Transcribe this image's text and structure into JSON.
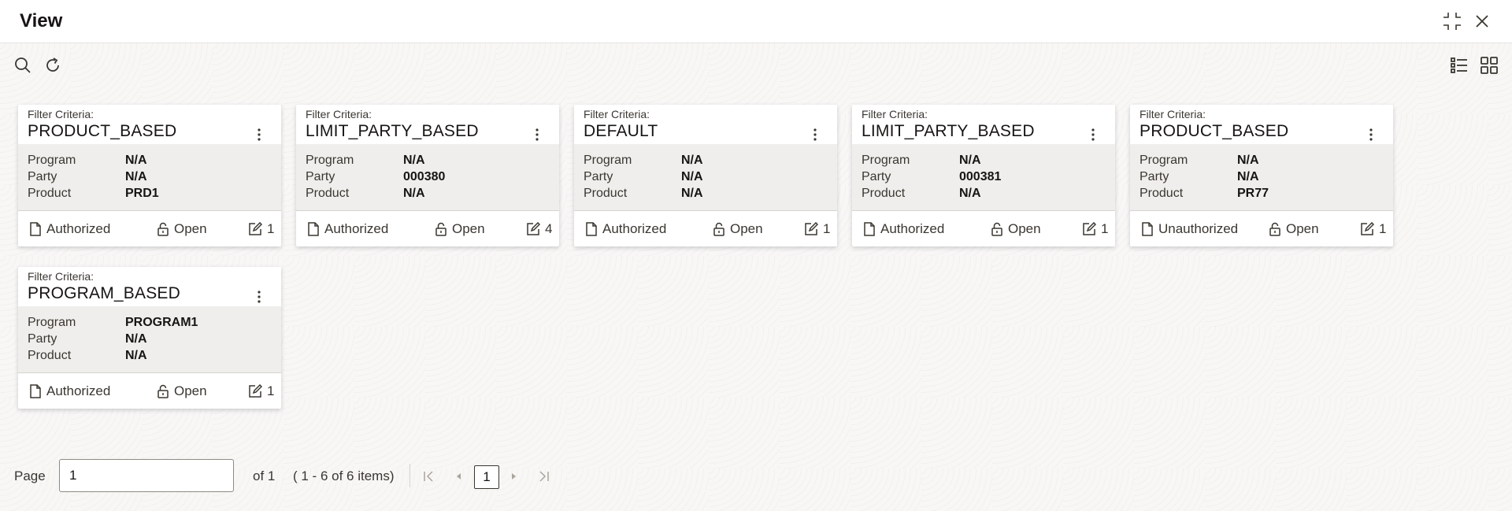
{
  "window": {
    "title": "View"
  },
  "icons": {
    "header": [
      "collapse-icon",
      "close-icon"
    ],
    "toolbar": [
      "search-icon",
      "refresh-icon",
      "list-view-icon",
      "grid-view-icon"
    ]
  },
  "cards": [
    {
      "filter_label": "Filter Criteria:",
      "criteria": "PRODUCT_BASED",
      "rows": [
        {
          "label": "Program",
          "value": "N/A"
        },
        {
          "label": "Party",
          "value": "N/A"
        },
        {
          "label": "Product",
          "value": "PRD1"
        }
      ],
      "status": "Authorized",
      "lock": "Open",
      "version": "1"
    },
    {
      "filter_label": "Filter Criteria:",
      "criteria": "LIMIT_PARTY_BASED",
      "rows": [
        {
          "label": "Program",
          "value": "N/A"
        },
        {
          "label": "Party",
          "value": "000380"
        },
        {
          "label": "Product",
          "value": "N/A"
        }
      ],
      "status": "Authorized",
      "lock": "Open",
      "version": "4"
    },
    {
      "filter_label": "Filter Criteria:",
      "criteria": "DEFAULT",
      "rows": [
        {
          "label": "Program",
          "value": "N/A"
        },
        {
          "label": "Party",
          "value": "N/A"
        },
        {
          "label": "Product",
          "value": "N/A"
        }
      ],
      "status": "Authorized",
      "lock": "Open",
      "version": "1"
    },
    {
      "filter_label": "Filter Criteria:",
      "criteria": "LIMIT_PARTY_BASED",
      "rows": [
        {
          "label": "Program",
          "value": "N/A"
        },
        {
          "label": "Party",
          "value": "000381"
        },
        {
          "label": "Product",
          "value": "N/A"
        }
      ],
      "status": "Authorized",
      "lock": "Open",
      "version": "1"
    },
    {
      "filter_label": "Filter Criteria:",
      "criteria": "PRODUCT_BASED",
      "rows": [
        {
          "label": "Program",
          "value": "N/A"
        },
        {
          "label": "Party",
          "value": "N/A"
        },
        {
          "label": "Product",
          "value": "PR77"
        }
      ],
      "status": "Unauthorized",
      "lock": "Open",
      "version": "1"
    },
    {
      "filter_label": "Filter Criteria:",
      "criteria": "PROGRAM_BASED",
      "rows": [
        {
          "label": "Program",
          "value": "PROGRAM1"
        },
        {
          "label": "Party",
          "value": "N/A"
        },
        {
          "label": "Product",
          "value": "N/A"
        }
      ],
      "status": "Authorized",
      "lock": "Open",
      "version": "1"
    }
  ],
  "pagination": {
    "page_label": "Page",
    "page_value": "1",
    "of_text": "of 1",
    "range_text": "( 1 - 6 of 6 items)",
    "current_page": "1"
  }
}
